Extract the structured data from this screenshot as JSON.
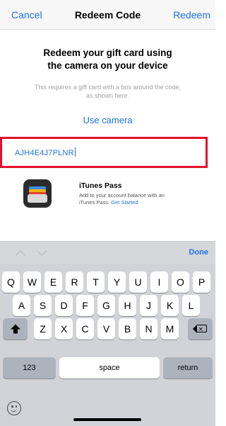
{
  "navbar": {
    "cancel_label": "Cancel",
    "title": "Redeem Code",
    "redeem_label": "Redeem"
  },
  "main": {
    "heading_line1": "Redeem your gift card using",
    "heading_line2": "the camera on your device",
    "subtext_line1": "This requires a gift card with a box around the code,",
    "subtext_line2": "as shown here.",
    "use_camera_label": "Use camera",
    "code_value": "AJH4E4J7PLNR",
    "pass_title": "iTunes Pass",
    "pass_desc_line1": "Add to your account balance with an",
    "pass_desc_line2": "iTunes Pass.",
    "pass_link": "Get Started"
  },
  "keyboard": {
    "done_label": "Done",
    "row1": [
      "Q",
      "W",
      "E",
      "R",
      "T",
      "Y",
      "U",
      "I",
      "O",
      "P"
    ],
    "row2": [
      "A",
      "S",
      "D",
      "F",
      "G",
      "H",
      "J",
      "K",
      "L"
    ],
    "row3": [
      "Z",
      "X",
      "C",
      "V",
      "B",
      "N",
      "M"
    ],
    "numbers_label": "123",
    "space_label": "space",
    "return_label": "return"
  },
  "colors": {
    "accent": "#1a73e8",
    "highlight_border": "#e5102c"
  }
}
